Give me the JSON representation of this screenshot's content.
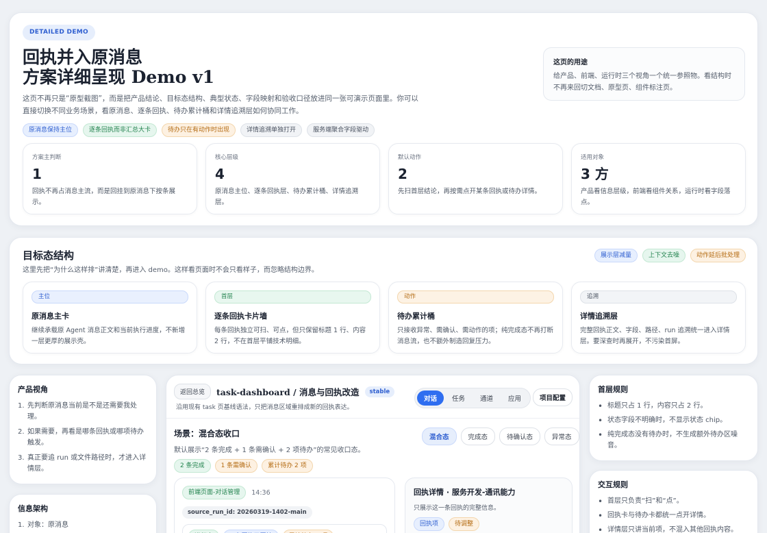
{
  "hero": {
    "badge": "DETAILED DEMO",
    "title_line1": "回执并入原消息",
    "title_line2": "方案详细呈现 Demo v1",
    "description": "这页不再只是“原型截图”，而是把产品结论、目标态结构、典型状态、字段映射和验收口径放进同一张可演示页面里。你可以直接切换不同业务场景，看原消息、逐条回执、待办累计桶和详情追溯层如何协同工作。",
    "tags": [
      {
        "label": "原消息保持主位",
        "tone": "blue"
      },
      {
        "label": "逐条回执而非汇总大卡",
        "tone": "green"
      },
      {
        "label": "待办只在有动作时出现",
        "tone": "orange"
      },
      {
        "label": "详情追溯单独打开",
        "tone": "gray"
      },
      {
        "label": "服务端聚合字段驱动",
        "tone": "gray"
      }
    ],
    "purpose": {
      "title": "这页的用途",
      "body": "给产品、前端、运行时三个视角一个统一参照物。看结构时不再来回切文档、原型页、组件标注页。"
    },
    "stats": [
      {
        "label": "方案主判断",
        "value": "1",
        "desc": "回执不再占消息主流，而是回挂到原消息下按条展示。"
      },
      {
        "label": "核心层级",
        "value": "4",
        "desc": "原消息主位、逐条回执层、待办累计桶、详情追溯层。"
      },
      {
        "label": "默认动作",
        "value": "2",
        "desc": "先扫首层结论，再按需点开某条回执或待办详情。"
      },
      {
        "label": "适用对象",
        "value": "3 方",
        "desc": "产品看信息层级，前端看组件关系，运行时看字段落点。"
      }
    ]
  },
  "structure": {
    "title": "目标态结构",
    "subtitle": "这里先把“为什么这样排”讲清楚，再进入 demo。这样看页面时不会只看样子，而忽略结构边界。",
    "tags": [
      {
        "label": "展示层减量",
        "tone": "blue"
      },
      {
        "label": "上下文去噪",
        "tone": "green"
      },
      {
        "label": "动作延后批处理",
        "tone": "orange"
      }
    ],
    "layers": [
      {
        "tag": "主位",
        "tone": "blue",
        "title": "原消息主卡",
        "desc": "继续承载原 Agent 消息正文和当前执行进度，不新增一层更厚的展示壳。"
      },
      {
        "tag": "首层",
        "tone": "green",
        "title": "逐条回执卡片墙",
        "desc": "每条回执独立可扫、可点，但只保留标题 1 行、内容 2 行，不在首层平铺技术明细。"
      },
      {
        "tag": "动作",
        "tone": "orange",
        "title": "待办累计桶",
        "desc": "只接收异常、需确认、需动作的项；纯完成态不再打断消息流，也不额外制造回复压力。"
      },
      {
        "tag": "追溯",
        "tone": "gray",
        "title": "详情追溯层",
        "desc": "完整回执正文、字段、路径、run 追溯统一进入详情层。要深查时再展开，不污染首屏。"
      }
    ]
  },
  "left_sidebar": {
    "product": {
      "title": "产品视角",
      "items": [
        "先判断原消息当前是不是还需要我处理。",
        "如果需要，再看是哪条回执或哪项待办触发。",
        "真正要追 run 或文件路径时，才进入详情层。"
      ]
    },
    "info": {
      "title": "信息架构",
      "items": [
        "对象：原消息"
      ]
    }
  },
  "demo": {
    "back_label": "返回总览",
    "title": "task-dashboard / 消息与回执改造",
    "stable": "stable",
    "subtitle": "沿用现有 task 页基线语法，只把消息区域重排成新的回执表达。",
    "tabs": [
      "对话",
      "任务",
      "通道",
      "应用"
    ],
    "active_tab": 0,
    "project_btn": "项目配置",
    "scene_title": "场景：混合态收口",
    "scene_desc": "默认展示“2 条完成 + 1 条需确认 + 2 项待办”的常见收口态。",
    "scene_tags": [
      {
        "label": "2 条完成",
        "tone": "green"
      },
      {
        "label": "1 条需确认",
        "tone": "orange"
      },
      {
        "label": "累计待办 2 项",
        "tone": "orange"
      }
    ],
    "scene_tabs": [
      "混合态",
      "完成态",
      "待确认态",
      "异常态"
    ],
    "message": {
      "source_tag": "前端页面-对话管理",
      "time": "14:36",
      "run_id": "source_run_id: 20260319-1402-main",
      "inner_tags": [
        {
          "label": "进行中",
          "tone": "green"
        },
        {
          "label": "3 条回执已回挂",
          "tone": "blue"
        },
        {
          "label": "累计待办 2 项",
          "tone": "orange"
        }
      ]
    },
    "detail": {
      "title": "回执详情 · 服务开发-通讯能力",
      "subtitle": "只展示这一条回执的完整信息。",
      "tags": [
        {
          "label": "回执项",
          "tone": "blue"
        },
        {
          "label": "待调整",
          "tone": "orange"
        }
      ]
    }
  },
  "right_sidebar": {
    "first_layer": {
      "title": "首层规则",
      "items": [
        "标题只占 1 行，内容只占 2 行。",
        "状态字段不明确时，不显示状态 chip。",
        "纯完成态没有待办时，不生成额外待办区噪音。"
      ]
    },
    "interaction": {
      "title": "交互规则",
      "items": [
        "首层只负责“扫”和“点”。",
        "回执卡与待办卡都统一点开详情。",
        "详情层只讲当前项，不混入其他回执内容。"
      ]
    }
  }
}
